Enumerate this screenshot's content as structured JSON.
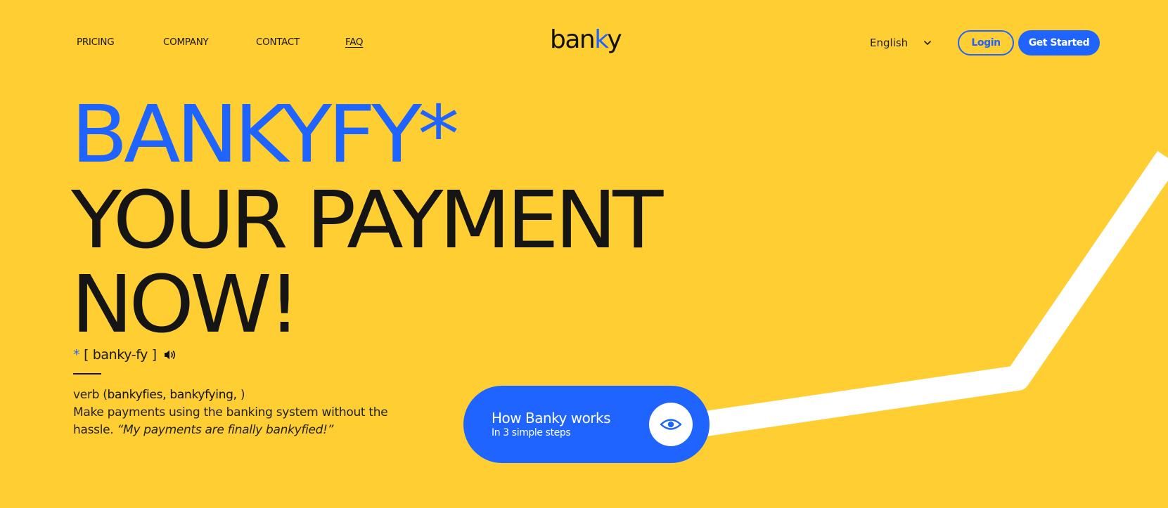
{
  "nav": {
    "links": [
      "PRICING",
      "COMPANY",
      "CONTACT",
      "FAQ"
    ]
  },
  "logo": {
    "text_main": "ban",
    "text_accent": "k",
    "text_end": "y"
  },
  "header": {
    "language": "English",
    "login_label": "Login",
    "get_started_label": "Get Started"
  },
  "hero": {
    "line1": "BANKYFY*",
    "line2": "YOUR PAYMENT",
    "line3": "NOW!",
    "pronunciation_asterisk": "*",
    "pronunciation": "[ banky-fy ]",
    "definition_prefix": "verb (",
    "definition_forms": "bankyfies, bankyfying,",
    "definition_suffix": " )",
    "definition_text": "Make payments using the banking system without the hassle. ",
    "definition_quote": "“My payments are finally bankyfied!”"
  },
  "how": {
    "title": "How Banky works",
    "subtitle": "In 3 simple steps"
  },
  "colors": {
    "background": "#FFCE33",
    "accent": "#1F64FF",
    "text": "#151515",
    "stripe": "#FFFFFF"
  },
  "icons": [
    "chevron-down-icon",
    "speaker-icon",
    "eye-icon"
  ]
}
